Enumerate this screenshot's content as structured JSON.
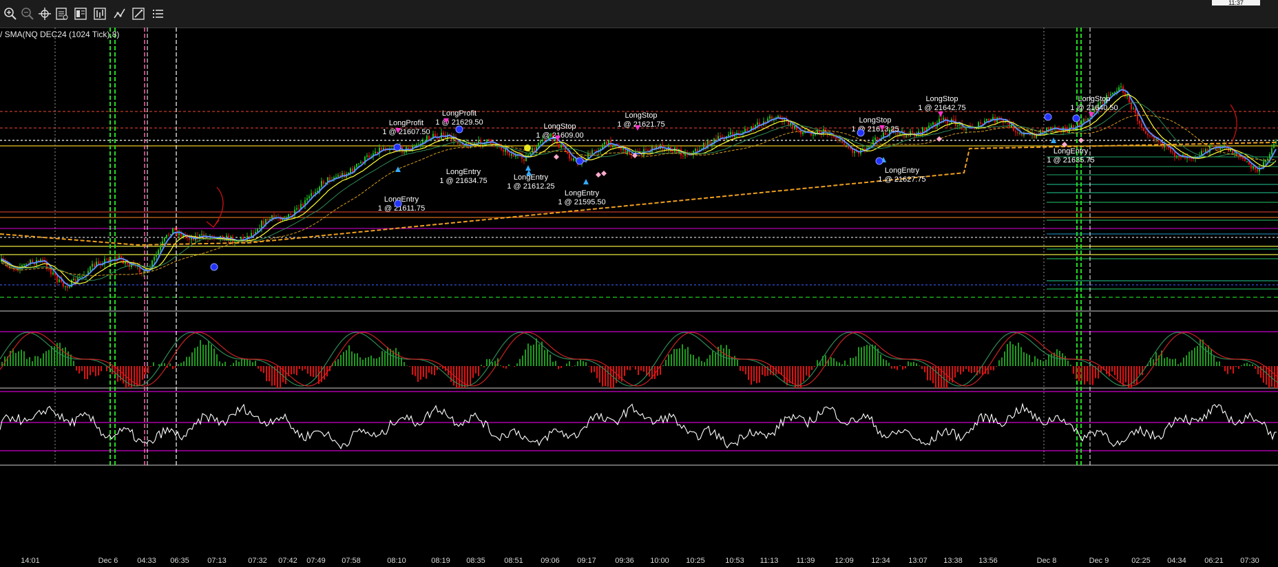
{
  "toolbar": {
    "clock": "11:37",
    "tools": [
      {
        "name": "zoom-in-icon"
      },
      {
        "name": "zoom-out-icon"
      },
      {
        "name": "crosshair-icon"
      },
      {
        "name": "data-box-icon"
      },
      {
        "name": "properties-icon"
      },
      {
        "name": "indicators-icon"
      },
      {
        "name": "strategies-icon"
      },
      {
        "name": "drawing-tools-icon"
      },
      {
        "name": "chart-list-icon"
      }
    ]
  },
  "chart_title": "/ SMA(NQ DEC24 (1024 Tick),8)",
  "chart_data": {
    "type": "candlestick",
    "instrument": "NQ DEC24 (1024 Tick)",
    "x_labels": [
      "14:01",
      "Dec 6",
      "04:33",
      "06:35",
      "07:13",
      "07:32",
      "07:42",
      "07:49",
      "07:58",
      "08:10",
      "08:19",
      "08:35",
      "08:51",
      "09:06",
      "09:17",
      "09:36",
      "10:00",
      "10:25",
      "10:53",
      "11:13",
      "11:39",
      "12:09",
      "12:34",
      "13:07",
      "13:38",
      "13:56",
      "Dec 8",
      "Dec 9",
      "02:25",
      "04:34",
      "06:21",
      "07:30"
    ],
    "trades": [
      {
        "signal": "LongProfit",
        "qty_price": "1 @ 21607.50"
      },
      {
        "signal": "LongProfit",
        "qty_price": "1 @ 21629.50"
      },
      {
        "signal": "LongEntry",
        "qty_price": "1 @ 21611.75"
      },
      {
        "signal": "LongEntry",
        "qty_price": "1 @ 21634.75"
      },
      {
        "signal": "LongStop",
        "qty_price": "1 @ 21609.00"
      },
      {
        "signal": "LongEntry",
        "qty_price": "1 @ 21612.25"
      },
      {
        "signal": "LongEntry",
        "qty_price": "1 @ 21595.50"
      },
      {
        "signal": "LongStop",
        "qty_price": "1 @ 21621.75"
      },
      {
        "signal": "LongStop",
        "qty_price": "1 @ 21613.25"
      },
      {
        "signal": "LongEntry",
        "qty_price": "1 @ 21627.75"
      },
      {
        "signal": "LongStop",
        "qty_price": "1 @ 21642.75"
      },
      {
        "signal": "LongStop",
        "qty_price": "1 @ 21640.50"
      },
      {
        "signal": "LongEntry",
        "qty_price": "1 @ 21635.75"
      }
    ],
    "colors": {
      "up_candle": "#1fbf1f",
      "down_candle": "#e01010",
      "sma_fast": "#5b8cff",
      "sma_mid": "#ffff33",
      "sma_slow": "#f0a020",
      "histogram_up": "#1e9a1e",
      "histogram_down": "#e01010",
      "oscillator": "#ffffff",
      "band_line": "#cc00cc"
    },
    "grid": false
  }
}
